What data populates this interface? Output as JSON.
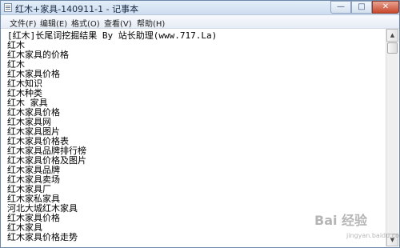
{
  "window": {
    "title": "红木+家具-140911-1 - 记事本",
    "buttons": {
      "minimize": "—",
      "maximize": "□",
      "close": "✕"
    }
  },
  "menu": {
    "items": [
      {
        "label": "文件(F)"
      },
      {
        "label": "编辑(E)"
      },
      {
        "label": "格式(O)"
      },
      {
        "label": "查看(V)"
      },
      {
        "label": "帮助(H)"
      }
    ]
  },
  "editor": {
    "lines": [
      "[红木]长尾词挖掘结果 By 站长助理(www.717.La)",
      "红木",
      "红木家具的价格",
      "红木",
      "红木家具价格",
      "红木知识",
      "红木种类",
      "红木 家具",
      "红木家具价格",
      "红木家具网",
      "红木家具图片",
      "红木家具价格表",
      "红木家具品牌排行榜",
      "红木家具价格及图片",
      "红木家具品牌",
      "红木家具卖场",
      "红木家具厂",
      "红木家私家具",
      "河北大城红木家具",
      "红木家具价格",
      "红木家具",
      "红木家具价格走势"
    ]
  },
  "scrollbar": {
    "up_arrow": "▲",
    "down_arrow": "▼"
  },
  "watermark": {
    "text": "Bai 经验",
    "sub": "jingyan.baidu.com"
  },
  "icons": {
    "app": "notepad-icon",
    "scroll_up": "arrow-up-icon",
    "scroll_down": "arrow-down-icon"
  }
}
